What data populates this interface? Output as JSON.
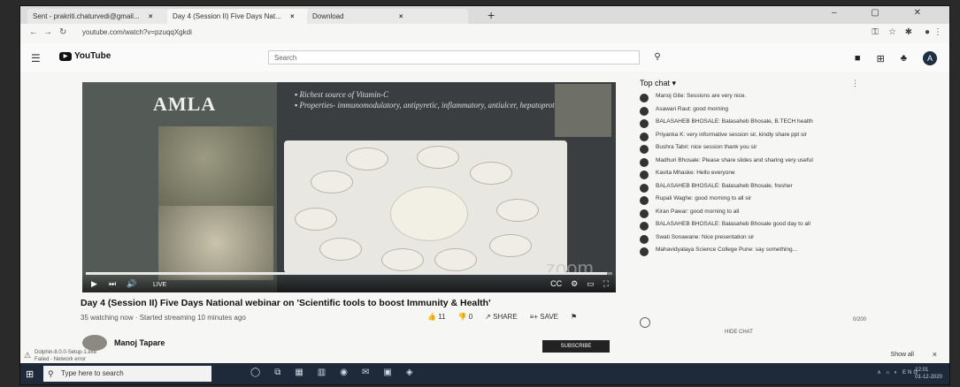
{
  "browser": {
    "tabs": [
      {
        "label": "Sent - prakriti.chaturvedi@gmail...",
        "close": "×"
      },
      {
        "label": "Day 4 (Session II) Five Days Nat...",
        "close": "×"
      },
      {
        "label": "Download",
        "close": "×"
      }
    ],
    "new_tab": "+",
    "window_controls": "–  ▢  ✕",
    "url": "youtube.com/watch?v=pzuqqXgkdi",
    "nav": {
      "back": "←",
      "forward": "→",
      "reload": "↻"
    }
  },
  "youtube": {
    "logo_text": "YouTube",
    "search_placeholder": "Search",
    "search_icon": "⚲",
    "avatar_letter": "A"
  },
  "video": {
    "slide_title": "AMLA",
    "bullets": [
      "Richest source of Vitamin-C",
      "Properties- immunomodulatory, antipyretic, inflammatory, antiulcer, hepatoprotective"
    ],
    "watermark": "zoom",
    "live_label": "LIVE",
    "progress": 0.99,
    "controls": [
      "▶",
      "⏭",
      "🔊"
    ],
    "right_controls": [
      "CC",
      "⚙",
      "▭",
      "⛶"
    ]
  },
  "info": {
    "title": "Day 4 (Session II) Five Days National webinar on 'Scientific tools to boost Immunity & Health'",
    "meta": "35 watching now · Started streaming 10 minutes ago",
    "actions": [
      {
        "icon": "👍",
        "label": "11"
      },
      {
        "icon": "👎",
        "label": "0"
      },
      {
        "icon": "↗",
        "label": "SHARE"
      },
      {
        "icon": "≡+",
        "label": "SAVE"
      },
      {
        "icon": "⚑",
        "label": ""
      }
    ],
    "channel_name": "Manoj Tapare",
    "subscribe_label": "SUBSCRIBE"
  },
  "chat": {
    "header": "Top chat ▾",
    "more": "⋮",
    "messages": [
      {
        "text": "Manoj Gite: Sessions are very nice."
      },
      {
        "text": "Asawari Raut: good morning"
      },
      {
        "text": "BALASAHEB BHOSALE: Balasaheb Bhosale, B.TECH health"
      },
      {
        "text": "Priyanka K: very informative session sir, kindly share ppt sir"
      },
      {
        "text": "Bushra Tabri: nice session thank you sir"
      },
      {
        "text": "Madhuri Bhosale: Please share slides and sharing very useful"
      },
      {
        "text": "Kavita Mhaske: Hello everyone"
      },
      {
        "text": "BALASAHEB BHOSALE: Balasaheb Bhosale, fresher"
      },
      {
        "text": "Rupali Waghe: good morning to all sir"
      },
      {
        "text": "Kiran Pawar: good morning to all"
      },
      {
        "text": "BALASAHEB BHOSALE: Balasaheb Bhosale good day to all"
      },
      {
        "text": "Swati Sonawane: Nice presentation sir"
      },
      {
        "text": "Mahavidyalaya Science College Pune: say something..."
      }
    ],
    "input_counter": "0/200",
    "hide_chat": "HIDE CHAT"
  },
  "downloads": {
    "item": "Dolphin-8.0.0-Setup-1.exe",
    "item_sub": "Failed - Network error",
    "show_all": "Show all",
    "close": "×"
  },
  "taskbar": {
    "start": "⊞",
    "search_placeholder": "Type here to search",
    "apps": [
      "◯",
      "⧉",
      "▦",
      "▥",
      "◉",
      "✉",
      "▣",
      "◈"
    ],
    "tray": "∧ ⌂ ◐ ENG",
    "time": "12:01",
    "date": "01-12-2020"
  }
}
